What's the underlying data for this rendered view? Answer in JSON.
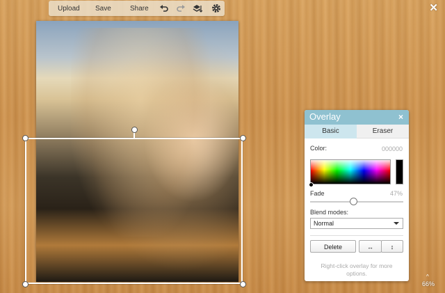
{
  "toolbar": {
    "upload_label": "Upload",
    "save_label": "Save",
    "share_label": "Share"
  },
  "panel": {
    "title": "Overlay",
    "close_glyph": "×",
    "tabs": [
      {
        "label": "Basic",
        "active": true
      },
      {
        "label": "Eraser",
        "active": false
      }
    ],
    "color_label": "Color:",
    "color_value": "000000",
    "fade_label": "Fade",
    "fade_value": "47%",
    "fade_fraction": 0.47,
    "blend_label": "Blend modes:",
    "blend_selected": "Normal",
    "delete_label": "Delete",
    "flip_h_glyph": "↔",
    "flip_v_glyph": "↕",
    "hint": "Right-click overlay for more options."
  },
  "zoom": {
    "value": "66%",
    "caret": "^"
  },
  "close_glyph": "✕",
  "colors": {
    "panel_header": "#8fc1d0",
    "active_tab": "#cde6ee",
    "swatch": "#000000"
  }
}
